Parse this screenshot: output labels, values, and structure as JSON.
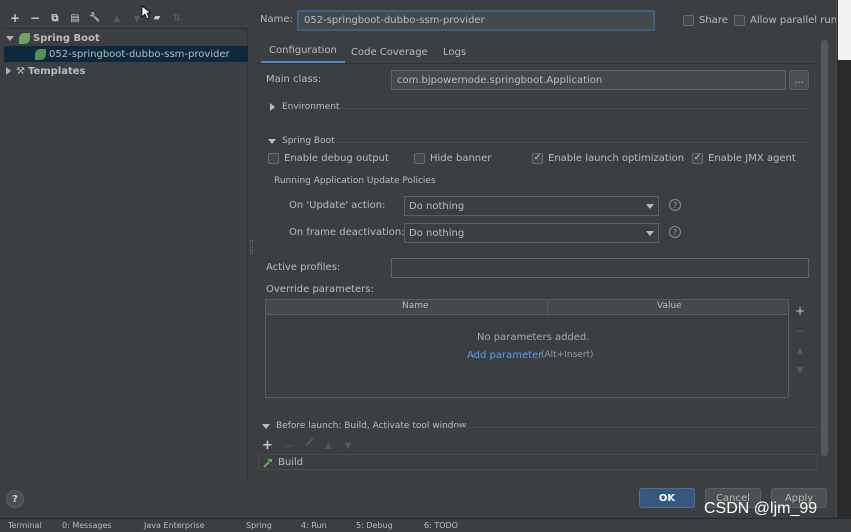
{
  "toolbar": {
    "add": "+",
    "remove": "−",
    "copy": "⧉",
    "save": "▤",
    "edit": "🔧",
    "up": "▲",
    "down": "▼",
    "folder": "▰",
    "sort": "⇅"
  },
  "tree": {
    "group_label": "Spring Boot",
    "item_label": "052-springboot-dubbo-ssm-provider",
    "templates_label": "Templates"
  },
  "header": {
    "name_label": "Name:",
    "name_value": "052-springboot-dubbo-ssm-provider",
    "share_label": "Share",
    "parallel_label": "Allow parallel run"
  },
  "tabs": [
    "Configuration",
    "Code Coverage",
    "Logs"
  ],
  "config": {
    "main_class_label": "Main class:",
    "main_class_value": "com.bjpowernode.springboot.Application",
    "browse_label": "...",
    "environment_label": "Environment",
    "spring_boot_label": "Spring Boot",
    "debug_label": "Enable debug output",
    "hide_banner_label": "Hide banner",
    "launch_opt_label": "Enable launch optimization",
    "jmx_label": "Enable JMX agent",
    "policies_label": "Running Application Update Policies",
    "update_action_label": "On 'Update' action:",
    "update_action_value": "Do nothing",
    "frame_deactivation_label": "On frame deactivation:",
    "frame_deactivation_value": "Do nothing",
    "active_profiles_label": "Active profiles:",
    "override_label": "Override parameters:",
    "col_name": "Name",
    "col_value": "Value",
    "empty_text": "No parameters added.",
    "add_param_link": "Add parameter",
    "add_param_shortcut": "(Alt+Insert)"
  },
  "before_launch": {
    "label": "Before launch: Build, Activate tool window",
    "build_item": "Build"
  },
  "buttons": {
    "help": "?",
    "ok": "OK",
    "cancel": "Cancel",
    "apply": "Apply"
  },
  "statusbar": {
    "terminal": "Terminal",
    "messages": "0: Messages",
    "java_enterprise": "Java Enterprise",
    "spring": "Spring",
    "run": "4: Run",
    "debug": "5: Debug",
    "todo": "6: TODO"
  },
  "watermark": "CSDN @ljm_99",
  "colors": {
    "accent": "#4a88c7",
    "ok_button": "#365880",
    "selection": "#0d293e",
    "link": "#589df6"
  }
}
